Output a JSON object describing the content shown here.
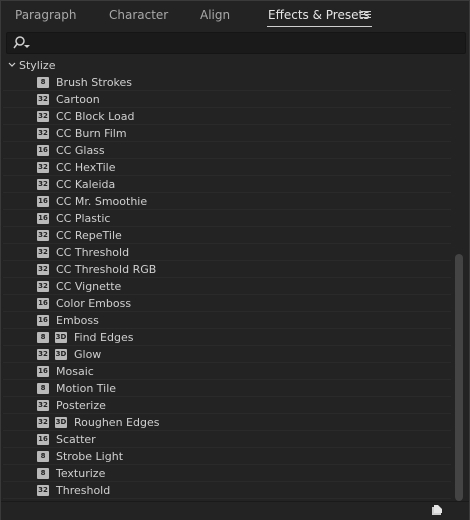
{
  "tabs": [
    {
      "label": "Paragraph"
    },
    {
      "label": "Character"
    },
    {
      "label": "Align"
    },
    {
      "label": "Effects & Presets",
      "active": true
    }
  ],
  "search": {
    "value": "",
    "placeholder": ""
  },
  "category": {
    "label": "Stylize",
    "expanded": true
  },
  "items": [
    {
      "label": "Brush Strokes",
      "badges": [
        "8"
      ]
    },
    {
      "label": "Cartoon",
      "badges": [
        "32"
      ]
    },
    {
      "label": "CC Block Load",
      "badges": [
        "32"
      ]
    },
    {
      "label": "CC Burn Film",
      "badges": [
        "32"
      ]
    },
    {
      "label": "CC Glass",
      "badges": [
        "16"
      ]
    },
    {
      "label": "CC HexTile",
      "badges": [
        "32"
      ]
    },
    {
      "label": "CC Kaleida",
      "badges": [
        "32"
      ]
    },
    {
      "label": "CC Mr. Smoothie",
      "badges": [
        "16"
      ]
    },
    {
      "label": "CC Plastic",
      "badges": [
        "16"
      ]
    },
    {
      "label": "CC RepeTile",
      "badges": [
        "32"
      ]
    },
    {
      "label": "CC Threshold",
      "badges": [
        "32"
      ]
    },
    {
      "label": "CC Threshold RGB",
      "badges": [
        "32"
      ]
    },
    {
      "label": "CC Vignette",
      "badges": [
        "32"
      ]
    },
    {
      "label": "Color Emboss",
      "badges": [
        "16"
      ]
    },
    {
      "label": "Emboss",
      "badges": [
        "16"
      ]
    },
    {
      "label": "Find Edges",
      "badges": [
        "8",
        "3D"
      ]
    },
    {
      "label": "Glow",
      "badges": [
        "32",
        "3D"
      ]
    },
    {
      "label": "Mosaic",
      "badges": [
        "16"
      ]
    },
    {
      "label": "Motion Tile",
      "badges": [
        "8"
      ]
    },
    {
      "label": "Posterize",
      "badges": [
        "32"
      ]
    },
    {
      "label": "Roughen Edges",
      "badges": [
        "32",
        "3D"
      ]
    },
    {
      "label": "Scatter",
      "badges": [
        "16"
      ]
    },
    {
      "label": "Strobe Light",
      "badges": [
        "8"
      ]
    },
    {
      "label": "Texturize",
      "badges": [
        "8"
      ]
    },
    {
      "label": "Threshold",
      "badges": [
        "32"
      ]
    }
  ],
  "icons": {
    "search": "search-icon",
    "menu": "hamburger-menu-icon",
    "new_folder": "new-folder-icon",
    "chevron": "chevron-down-icon",
    "badge": "bit-depth-badge-icon"
  },
  "colors": {
    "background": "#232323",
    "text": "#c8c8c8",
    "badge": "#b9b9b9",
    "accent_underline": "#cfcfcf"
  }
}
